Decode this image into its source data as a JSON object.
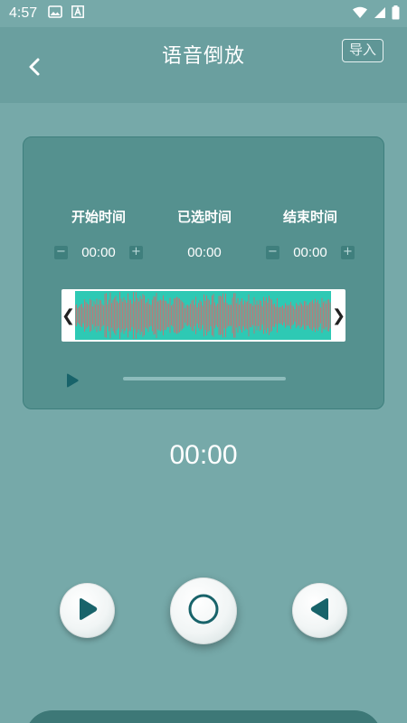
{
  "status_bar": {
    "time": "4:57"
  },
  "header": {
    "title": "语音倒放",
    "import_label": "导入"
  },
  "panel": {
    "start": {
      "label": "开始时间",
      "value": "00:00",
      "minus": "−",
      "plus": "+"
    },
    "selected": {
      "label": "已选时间",
      "value": "00:00"
    },
    "end": {
      "label": "结束时间",
      "value": "00:00",
      "minus": "−",
      "plus": "+"
    },
    "waveform": {
      "left_handle": "❮",
      "right_handle": "❯"
    },
    "playback_progress": 0
  },
  "main_time": "00:00",
  "colors": {
    "background": "#76a9a9",
    "panel": "#55918f",
    "waveform_bg": "#2ec9b4",
    "waveform_bars": "#b77b7a",
    "controls_icon": "#18636a"
  },
  "icons": {
    "back": "chevron-left-icon",
    "play": "play-icon",
    "record": "record-icon",
    "reverse": "reverse-play-icon"
  }
}
